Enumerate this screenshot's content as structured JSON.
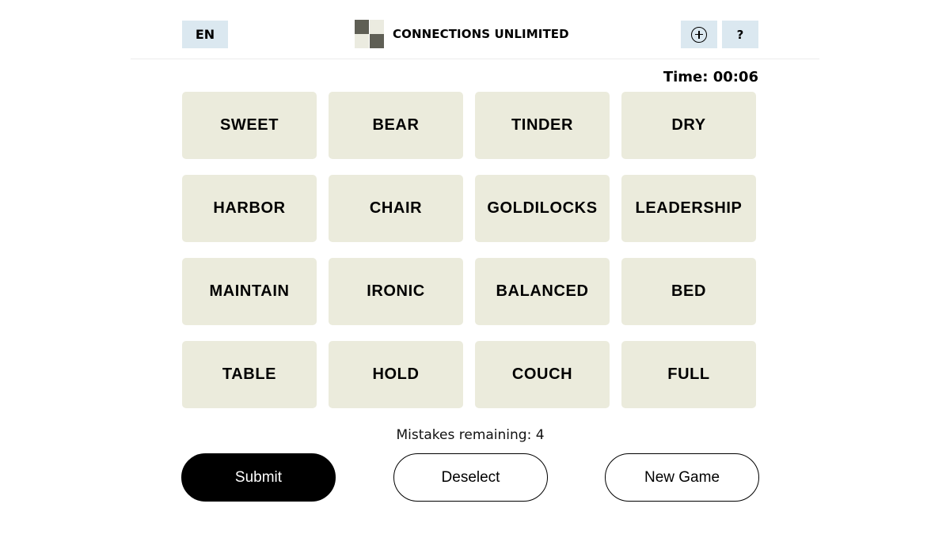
{
  "header": {
    "language_label": "EN",
    "title": "CONNECTIONS UNLIMITED",
    "add_icon": "plus-circle-icon",
    "help_label": "?"
  },
  "timer": {
    "text": "Time: 00:06"
  },
  "grid": {
    "tiles": [
      "SWEET",
      "BEAR",
      "TINDER",
      "DRY",
      "HARBOR",
      "CHAIR",
      "GOLDILOCKS",
      "LEADERSHIP",
      "MAINTAIN",
      "IRONIC",
      "BALANCED",
      "BED",
      "TABLE",
      "HOLD",
      "COUCH",
      "FULL"
    ]
  },
  "status": {
    "mistakes_text": "Mistakes remaining: 4"
  },
  "actions": {
    "submit_label": "Submit",
    "deselect_label": "Deselect",
    "new_game_label": "New Game"
  },
  "colors": {
    "tile_bg": "#ebebdc",
    "header_button_bg": "#dbe8f0",
    "logo_dark": "#5f5f55",
    "logo_light": "#ebebe0",
    "submit_bg": "#000000"
  }
}
